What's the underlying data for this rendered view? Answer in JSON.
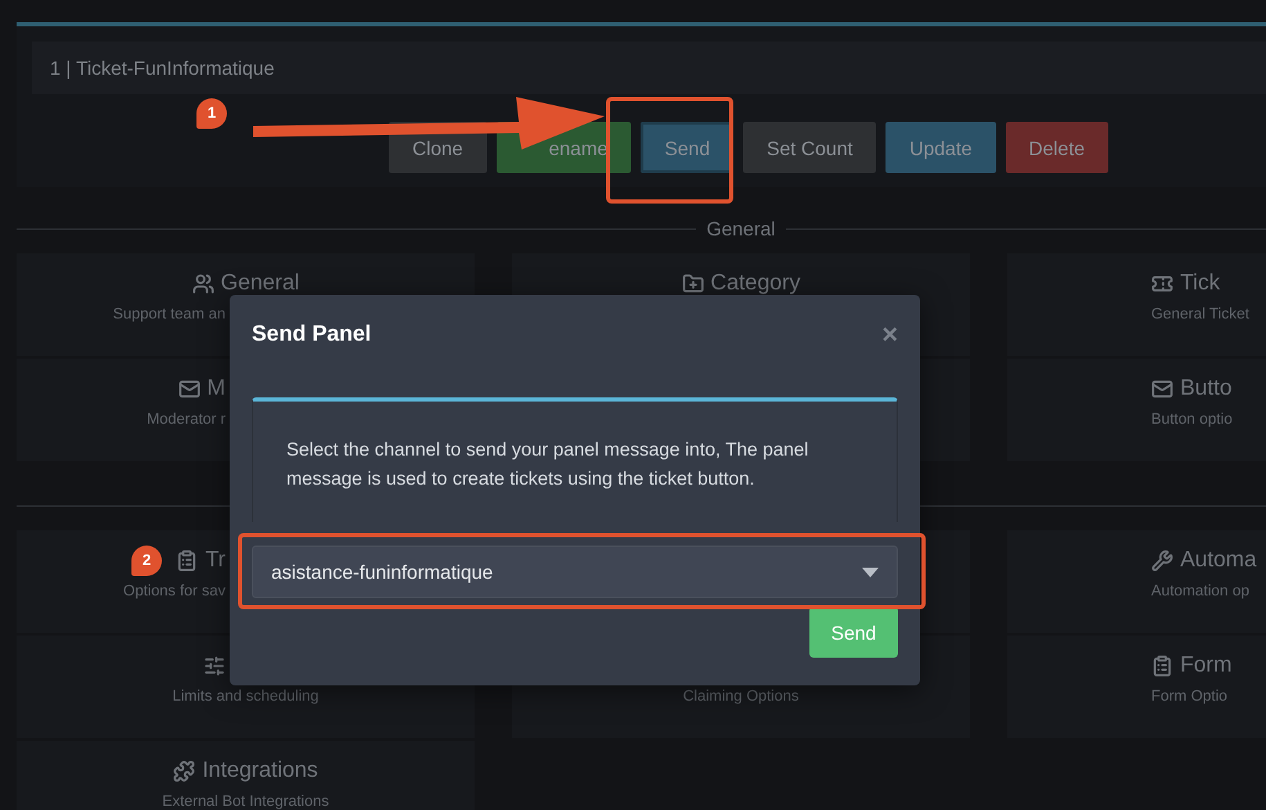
{
  "panel": {
    "title": "1 | Ticket-FunInformatique",
    "actions": [
      {
        "label": "Clone",
        "kind": "default",
        "selected": false
      },
      {
        "label": "ename",
        "kind": "success",
        "selected": false
      },
      {
        "label": "Send",
        "kind": "info",
        "selected": true
      },
      {
        "label": "Set Count",
        "kind": "default",
        "selected": false
      },
      {
        "label": "Update",
        "kind": "info",
        "selected": false
      },
      {
        "label": "Delete",
        "kind": "danger",
        "selected": false
      }
    ]
  },
  "sections": [
    {
      "title": "General",
      "cards": [
        {
          "title": "General",
          "subtitle": "Support team an"
        },
        {
          "title": "Category"
        },
        {
          "title": "Tick",
          "subtitle": "General Ticket"
        },
        {
          "title": "M",
          "subtitle": "Moderator r"
        },
        {
          "title": "Butto",
          "subtitle": "Button optio"
        }
      ]
    },
    {
      "cards": [
        {
          "title": "Tr",
          "subtitle": "Options for sav"
        },
        {
          "title": "Automa",
          "subtitle": "Automation op"
        },
        {
          "subtitle": "Limits and scheduling"
        },
        {
          "subtitle": "Claiming Options"
        },
        {
          "title": "Form",
          "subtitle": "Form Optio"
        },
        {
          "title": "Integrations",
          "subtitle": "External Bot Integrations"
        }
      ]
    }
  ],
  "modal": {
    "title": "Send Panel",
    "close": "×",
    "message": "Select the channel to send your panel message into, The panel message is used to create tickets using the ticket button.",
    "channel": "asistance-funinformatique",
    "submit": "Send"
  },
  "annotations": [
    {
      "number": "1"
    },
    {
      "number": "2"
    }
  ]
}
